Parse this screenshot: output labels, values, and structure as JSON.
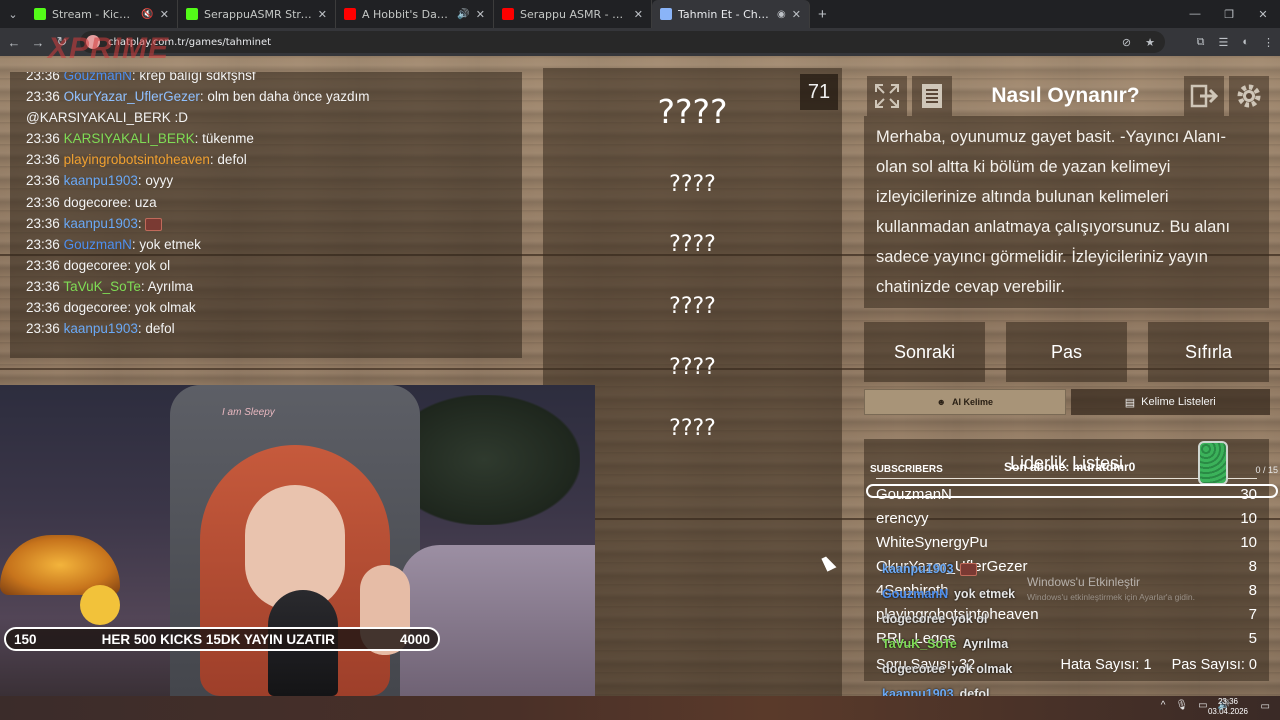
{
  "browser": {
    "tabs": [
      {
        "title": "Stream - Kick Dashboard",
        "favicon_color": "#53fc18"
      },
      {
        "title": "SerappuASMR Stream - Watch",
        "favicon_color": "#53fc18"
      },
      {
        "title": "A Hobbit's Day in the Shire",
        "favicon_color": "#ff0000"
      },
      {
        "title": "Serappu ASMR - YouTube",
        "favicon_color": "#ff0000"
      },
      {
        "title": "Tahmin Et - ChatPlay",
        "favicon_color": "#8ab4f8"
      }
    ],
    "url": "chatplay.com.tr/games/tahminet",
    "watermark": "XPRIME"
  },
  "chat": {
    "messages": [
      {
        "time": "23:36",
        "user": "GouzmanN",
        "color": "#4d8ff0",
        "text": ": krep balığı sdkfşhsf"
      },
      {
        "time": "23:36",
        "user": "OkurYazar_UflerGezer",
        "color": "#8fc0ff",
        "text": ": olm ben daha önce yazdım"
      },
      {
        "time": "",
        "user": "",
        "color": "#ffffff",
        "text": "@KARSIYAKALI_BERK :D"
      },
      {
        "time": "23:36",
        "user": "KARSIYAKALI_BERK",
        "color": "#7fdc55",
        "text": ": tükenme"
      },
      {
        "time": "23:36",
        "user": "playingrobotsintoheaven",
        "color": "#f0a030",
        "text": ": defol"
      },
      {
        "time": "23:36",
        "user": "kaanpu1903",
        "color": "#6aa8f5",
        "text": ": oyyy"
      },
      {
        "time": "23:36",
        "user": "dogecoree",
        "color": "#ffffff",
        "text": ": uza"
      },
      {
        "time": "23:36",
        "user": "kaanpu1903",
        "color": "#6aa8f5",
        "text": ": ",
        "emote": true
      },
      {
        "time": "23:36",
        "user": "GouzmanN",
        "color": "#4d8ff0",
        "text": ": yok etmek"
      },
      {
        "time": "23:36",
        "user": "dogecoree",
        "color": "#ffffff",
        "text": ": yok ol"
      },
      {
        "time": "23:36",
        "user": "TaVuK_SoTe",
        "color": "#7fdc55",
        "text": ": Ayrılma"
      },
      {
        "time": "23:36",
        "user": "dogecoree",
        "color": "#ffffff",
        "text": ": yok olmak"
      },
      {
        "time": "23:36",
        "user": "kaanpu1903",
        "color": "#6aa8f5",
        "text": ": defol"
      }
    ]
  },
  "game": {
    "counter": "71",
    "words": [
      "????",
      "????",
      "????",
      "????",
      "????",
      "????"
    ],
    "title": "Nasıl Oynanır?",
    "instructions": "Merhaba, oyunumuz gayet basit. -Yayıncı Alanı- olan sol altta ki bölüm de yazan kelimeyi izleyicilerinize altında bulunan kelimeleri kullanmadan anlatmaya çalışıyorsunuz. Bu alanı sadece yayıncı görmelidir. İzleyicileriniz yayın chatinizde cevap verebilir.",
    "buttons": {
      "next": "Sonraki",
      "pass": "Pas",
      "reset": "Sıfırla"
    },
    "tabs": {
      "ai": "AI Kelime",
      "lists": "Kelime Listeleri"
    },
    "leaderboard": {
      "title": "Liderlik Listesi",
      "rows": [
        {
          "name": "GouzmanN",
          "score": "30"
        },
        {
          "name": "erencyy",
          "score": "10"
        },
        {
          "name": "WhiteSynergyPu",
          "score": "10"
        },
        {
          "name": "OkurYazar_UflerGezer",
          "score": "8"
        },
        {
          "name": "4Sephiroth",
          "score": "8"
        },
        {
          "name": "playingrobotsintoheaven",
          "score": "7"
        },
        {
          "name": "RRL_Legos",
          "score": "5"
        }
      ],
      "questions": "Soru Sayısı: 32",
      "errors": "Hata Sayısı: 1",
      "passes": "Pas Sayısı: 0"
    }
  },
  "overlay": {
    "sub_label": "SUBSCRIBERS",
    "last_sub": "Son abone: muratdmr0",
    "sub_count": "0 / 15",
    "chat": [
      {
        "user": "kaanpu1903",
        "text": ""
      },
      {
        "user": "GouzmanN",
        "text": "yok etmek"
      },
      {
        "user": "dogecoree",
        "text": "yok ol"
      },
      {
        "user": "TaVuK_SoTe",
        "text": "Ayrılma"
      },
      {
        "user": "dogecoree",
        "text": "yok olmak"
      },
      {
        "user": "kaanpu1903",
        "text": "defol"
      }
    ],
    "windows_title": "Windows'u Etkinleştir",
    "windows_sub": "Windows'u etkinleştirmek için Ayarlar'a gidin.",
    "kick_left": "150",
    "kick_text": "HER 500 KICKS 15DK YAYIN UZATIR",
    "kick_right": "4000",
    "chair_text": "I am Sleepy"
  },
  "taskbar": {
    "time": "23:36",
    "date": "03.04.2026"
  }
}
